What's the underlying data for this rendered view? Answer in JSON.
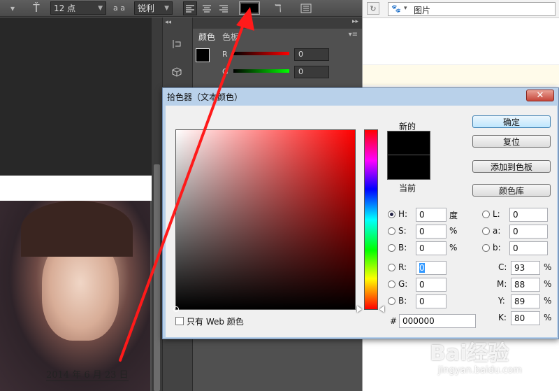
{
  "options_bar": {
    "font_size": "12 点",
    "aa_label": "a a",
    "aa_mode": "锐利",
    "text_color": "#000000"
  },
  "panel": {
    "tabs": [
      "颜色",
      "色板"
    ],
    "sliders": [
      {
        "label": "R",
        "value": "0"
      },
      {
        "label": "G",
        "value": "0"
      }
    ]
  },
  "browser": {
    "address_text": "图片"
  },
  "dialog": {
    "title": "拾色器（文本颜色）",
    "new_label": "新的",
    "current_label": "当前",
    "ok_button": "确定",
    "reset_button": "复位",
    "add_swatch_button": "添加到色板",
    "library_button": "颜色库",
    "web_only_label": "只有 Web 颜色",
    "hsb": [
      {
        "label": "H:",
        "value": "0",
        "unit": "度",
        "selected": true
      },
      {
        "label": "S:",
        "value": "0",
        "unit": "%"
      },
      {
        "label": "B:",
        "value": "0",
        "unit": "%"
      }
    ],
    "rgb": [
      {
        "label": "R:",
        "value": "0"
      },
      {
        "label": "G:",
        "value": "0"
      },
      {
        "label": "B:",
        "value": "0"
      }
    ],
    "lab": [
      {
        "label": "L:",
        "value": "0"
      },
      {
        "label": "a:",
        "value": "0"
      },
      {
        "label": "b:",
        "value": "0"
      }
    ],
    "cmyk": [
      {
        "label": "C:",
        "value": "93",
        "unit": "%"
      },
      {
        "label": "M:",
        "value": "88",
        "unit": "%"
      },
      {
        "label": "Y:",
        "value": "89",
        "unit": "%"
      },
      {
        "label": "K:",
        "value": "80",
        "unit": "%"
      }
    ],
    "hex_label": "#",
    "hex_value": "000000"
  },
  "canvas": {
    "date_text": "2014 年 6 月 23 日"
  },
  "watermark": {
    "brand": "Bai经验",
    "url": "jingyan.baidu.com"
  },
  "colors": {
    "arrow": "#ff1a1a",
    "current_color": "#000000"
  }
}
